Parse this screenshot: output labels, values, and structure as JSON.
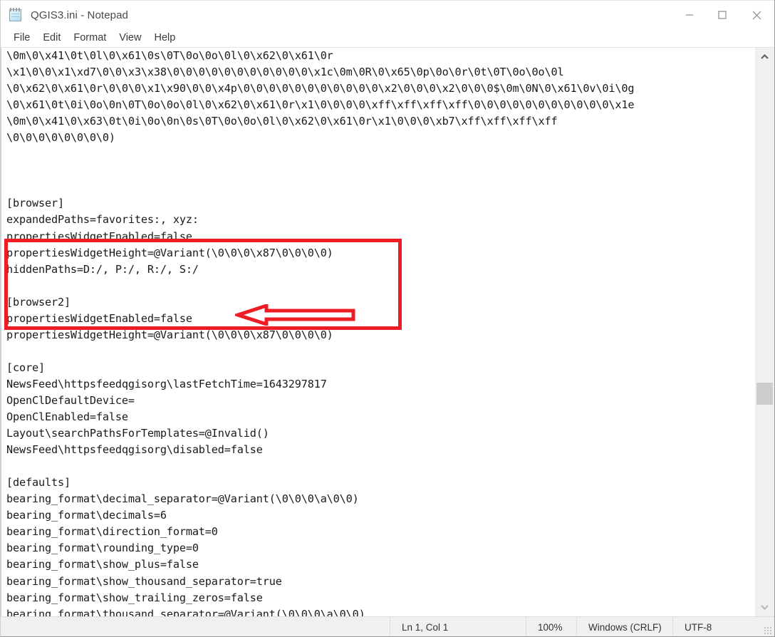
{
  "window": {
    "title": "QGIS3.ini - Notepad",
    "icon": "notepad-icon",
    "controls": {
      "minimize": "minimize-icon",
      "maximize": "maximize-icon",
      "close": "close-icon"
    }
  },
  "menubar": {
    "items": [
      {
        "label": "File"
      },
      {
        "label": "Edit"
      },
      {
        "label": "Format"
      },
      {
        "label": "View"
      },
      {
        "label": "Help"
      }
    ]
  },
  "editor": {
    "content": "\\0m\\0\\x41\\0t\\0l\\0\\x61\\0s\\0T\\0o\\0o\\0l\\0\\x62\\0\\x61\\0r\n\\x1\\0\\0\\x1\\xd7\\0\\0\\x3\\x38\\0\\0\\0\\0\\0\\0\\0\\0\\0\\0\\0\\x1c\\0m\\0R\\0\\x65\\0p\\0o\\0r\\0t\\0T\\0o\\0o\\0l\n\\0\\x62\\0\\x61\\0r\\0\\0\\0\\x1\\x90\\0\\0\\x4p\\0\\0\\0\\0\\0\\0\\0\\0\\0\\0\\0\\x2\\0\\0\\0\\x2\\0\\0\\0$\\0m\\0N\\0\\x61\\0v\\0i\\0g\n\\0\\x61\\0t\\0i\\0o\\0n\\0T\\0o\\0o\\0l\\0\\x62\\0\\x61\\0r\\x1\\0\\0\\0\\0\\xff\\xff\\xff\\xff\\0\\0\\0\\0\\0\\0\\0\\0\\0\\0\\0\\x1e\n\\0m\\0\\x41\\0\\x63\\0t\\0i\\0o\\0n\\0s\\0T\\0o\\0o\\0l\\0\\x62\\0\\x61\\0r\\x1\\0\\0\\0\\xb7\\xff\\xff\\xff\\xff\n\\0\\0\\0\\0\\0\\0\\0\\0)\n\n\n\n[browser]\nexpandedPaths=favorites:, xyz:\npropertiesWidgetEnabled=false\npropertiesWidgetHeight=@Variant(\\0\\0\\0\\x87\\0\\0\\0\\0)\nhiddenPaths=D:/, P:/, R:/, S:/\n\n[browser2]\npropertiesWidgetEnabled=false\npropertiesWidgetHeight=@Variant(\\0\\0\\0\\x87\\0\\0\\0\\0)\n\n[core]\nNewsFeed\\httpsfeedqgisorg\\lastFetchTime=1643297817\nOpenClDefaultDevice=\nOpenClEnabled=false\nLayout\\searchPathsForTemplates=@Invalid()\nNewsFeed\\httpsfeedqgisorg\\disabled=false\n\n[defaults]\nbearing_format\\decimal_separator=@Variant(\\0\\0\\0\\a\\0\\0)\nbearing_format\\decimals=6\nbearing_format\\direction_format=0\nbearing_format\\rounding_type=0\nbearing_format\\show_plus=false\nbearing_format\\show_thousand_separator=true\nbearing_format\\show_trailing_zeros=false\nbearing_format\\thousand_separator=@Variant(\\0\\0\\0\\a\\0\\0)"
  },
  "scrollbar": {
    "up_arrow": "chevron-up-icon",
    "down_arrow": "chevron-down-icon"
  },
  "statusbar": {
    "position": "Ln 1, Col 1",
    "zoom": "100%",
    "line_ending": "Windows (CRLF)",
    "encoding": "UTF-8"
  },
  "annotations": {
    "highlight_color": "#ee1c25",
    "box": {
      "target_section": "[browser]"
    },
    "arrow": {
      "points_to": "hiddenPaths=D:/, P:/, R:/, S:/"
    }
  }
}
